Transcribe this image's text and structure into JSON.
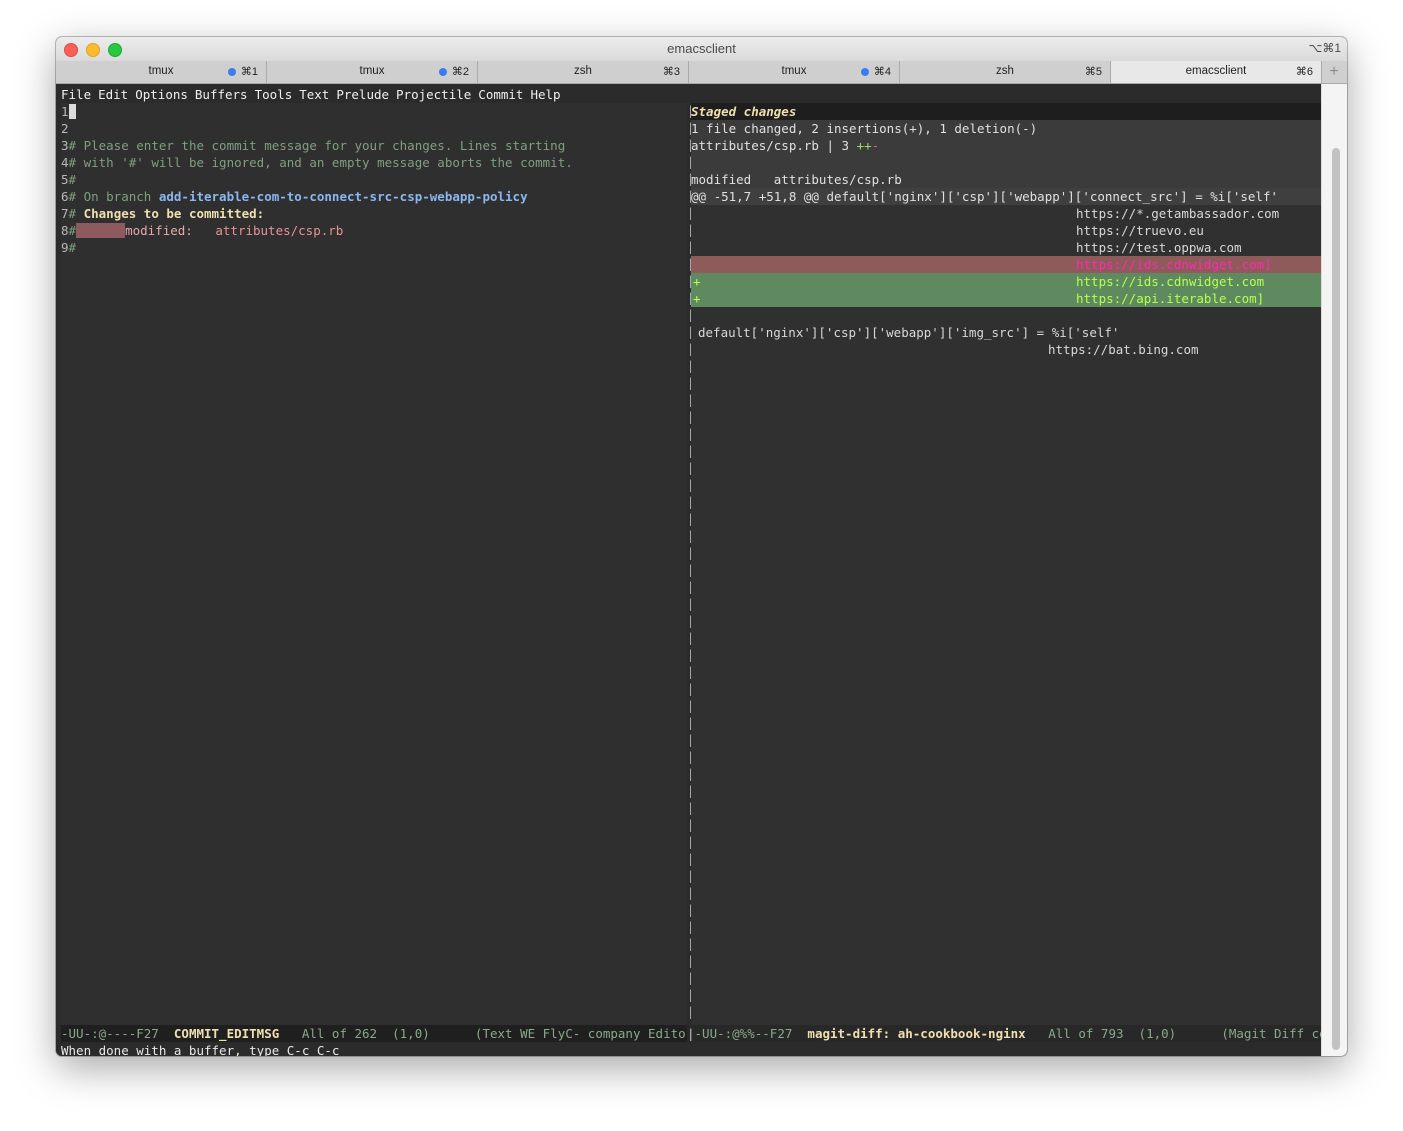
{
  "window": {
    "title": "emacsclient",
    "shortcut": "⌥⌘1"
  },
  "tabs": [
    {
      "label": "tmux",
      "shortcut": "⌘1",
      "activity_dot": true,
      "active": false
    },
    {
      "label": "tmux",
      "shortcut": "⌘2",
      "activity_dot": true,
      "active": false
    },
    {
      "label": "zsh",
      "shortcut": "⌘3",
      "activity_dot": false,
      "active": false
    },
    {
      "label": "tmux",
      "shortcut": "⌘4",
      "activity_dot": true,
      "active": false
    },
    {
      "label": "zsh",
      "shortcut": "⌘5",
      "activity_dot": false,
      "active": false
    },
    {
      "label": "emacsclient",
      "shortcut": "⌘6",
      "activity_dot": false,
      "active": true
    }
  ],
  "tab_add_label": "+",
  "menu": [
    "File",
    "Edit",
    "Options",
    "Buffers",
    "Tools",
    "Text",
    "Prelude",
    "Projectile",
    "Commit",
    "Help"
  ],
  "commit_buffer": {
    "line_numbers": [
      "1",
      "2",
      "3",
      "4",
      "5",
      "6",
      "7",
      "8",
      "9"
    ],
    "line3": "# Please enter the commit message for your changes. Lines starting",
    "line4": "# with '#' will be ignored, and an empty message aborts the commit.",
    "line5": "#",
    "line6_prefix": "# On branch ",
    "branch": "add-iterable-com-to-connect-src-csp-webapp-policy",
    "line7_hash": "# ",
    "line7_text": "Changes to be committed:",
    "line8_hash": "#",
    "line8_status": "modified:",
    "line8_file": "attributes/csp.rb",
    "line9": "#"
  },
  "diff_buffer": {
    "section_title": "Staged changes",
    "summary": "1 file changed, 2 insertions(+), 1 deletion(-)",
    "stat_file": "attributes/csp.rb | 3 ",
    "stat_plus": "++",
    "stat_minus": "-",
    "file_header": "modified   attributes/csp.rb",
    "hunk_header": "@@ -51,7 +51,8 @@ default['nginx']['csp']['webapp']['connect_src'] = %i['self'",
    "context_before": [
      "https://*.getambassador.com",
      "https://truevo.eu",
      "https://test.oppwa.com"
    ],
    "removed": [
      "https://ids.cdnwidget.com]"
    ],
    "added": [
      "https://ids.cdnwidget.com",
      "https://api.iterable.com]"
    ],
    "plus_marker": "+",
    "context_after_1": "default['nginx']['csp']['webapp']['img_src'] = %i['self'",
    "context_after_2": "https://bat.bing.com"
  },
  "modeline_left": {
    "flags": "-UU-:@----F27  ",
    "buffer": "COMMIT_EDITMSG",
    "position": "   All of 262  (1,0)      ",
    "modes": "(Text WE FlyC- company EditorConfi"
  },
  "modeline_right": {
    "flags": "-UU-:@%%--F27  ",
    "buffer": "magit-diff: ah-cookbook-nginx",
    "position": "   All of 793  (1,0)      ",
    "modes": "(Magit Diff company"
  },
  "echo_area": "When done with a buffer, type C-c C-c"
}
